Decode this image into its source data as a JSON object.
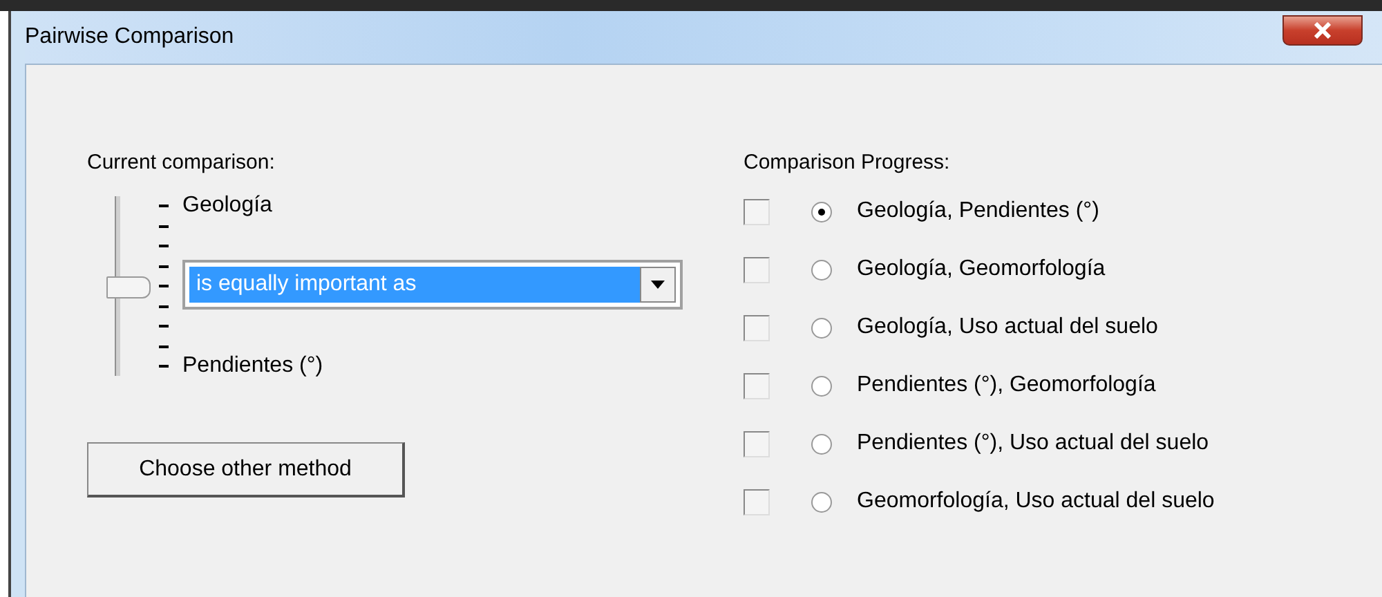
{
  "window": {
    "title": "Pairwise Comparison"
  },
  "current": {
    "label": "Current comparison:",
    "top_label": "Geología",
    "bottom_label": "Pendientes (°)",
    "slider": {
      "level": 0.5
    },
    "dropdown": {
      "value": "is equally important as"
    }
  },
  "button": "Choose other method",
  "progress": {
    "label": "Comparison Progress:",
    "items": [
      {
        "label": "Geología, Pendientes (°)",
        "checked": false,
        "selected": true
      },
      {
        "label": "Geología, Geomorfología",
        "checked": false,
        "selected": false
      },
      {
        "label": "Geología, Uso actual del suelo",
        "checked": false,
        "selected": false
      },
      {
        "label": "Pendientes (°), Geomorfología",
        "checked": false,
        "selected": false
      },
      {
        "label": "Pendientes (°), Uso actual del suelo",
        "checked": false,
        "selected": false
      },
      {
        "label": "Geomorfología, Uso actual del suelo",
        "checked": false,
        "selected": false
      }
    ]
  }
}
